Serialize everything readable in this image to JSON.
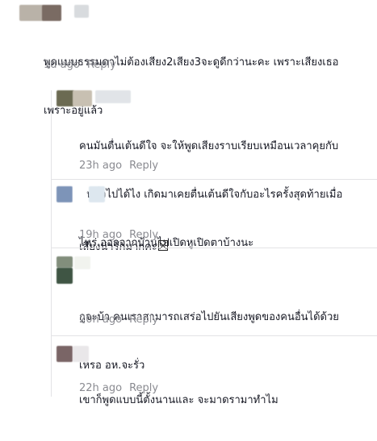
{
  "comments": [
    {
      "text_lines": [
        "พูดแบบธรรมดาไม่ต้องเสียง2เสียง3จะดูดีกว่านะคะ เพราะเสียงเธอ",
        "เพราะอยู่แล้ว"
      ],
      "time": "1d ago",
      "reply_label": "Reply",
      "avatar": [
        "#b9b2a8",
        "#7a6b63",
        "#d8dbde"
      ]
    },
    {
      "text_lines": [
        "คนมันตื่นเต้นดีใจ จะให้พูดเสียงราบเรียบเหมือนเวลาคุยกับ",
        "คนทั่วไปได้ไง เกิดมาเคยตื่นเต้นดีใจกับอะไรครั้งสุดท้ายเมื่อ",
        "ไหร่ ออกจากบ้านไปเปิดหูเปิดตาบ้างนะ"
      ],
      "time": "23h ago",
      "reply_label": "Reply",
      "avatar": [
        "#6b6a52",
        "#c8c0b2",
        "#e1e4e8"
      ]
    },
    {
      "text_lines": [
        "เสียงน่ารักมากคะ"
      ],
      "time": "19h ago",
      "reply_label": "Reply",
      "avatar": [
        "#7d94b8",
        "#ffffff",
        "#dde7ef"
      ]
    },
    {
      "text_lines": [
        "กูจะบ้า คนเราสามารถเสร่อไปยันเสียงพูดของคนอื่นได้ด้วย",
        "เหรอ อห.จะรั่ว"
      ],
      "time": "20h ago",
      "reply_label": "Reply",
      "avatar": [
        "#828e7c",
        "#3f5544",
        "#f1f3ee"
      ]
    },
    {
      "text_lines": [
        "เขาก็พูดแบบนี้ตั้งนานและ จะมาดรามาทำไม"
      ],
      "time": "22h ago",
      "reply_label": "Reply",
      "avatar": [
        "#7a6566",
        "#e9e7e9",
        "#ffffff"
      ]
    }
  ]
}
